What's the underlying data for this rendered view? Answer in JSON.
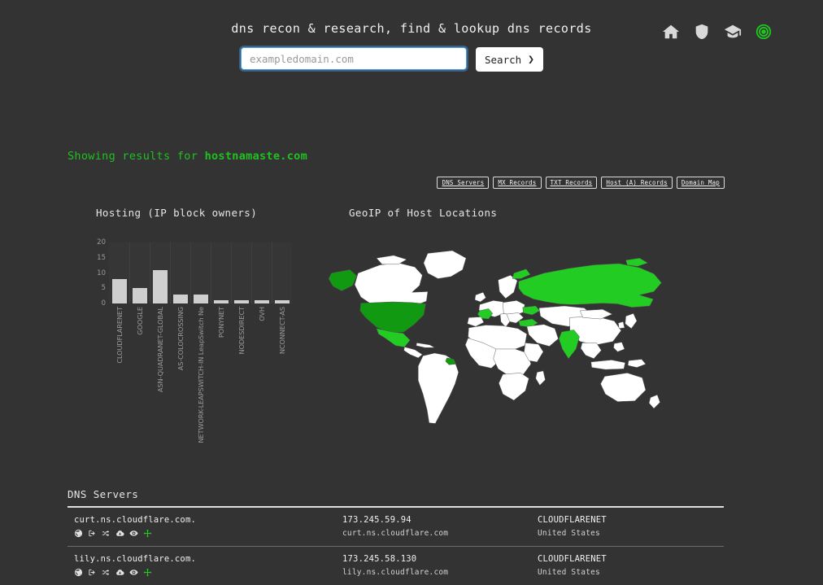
{
  "header": {
    "title": "dns recon & research, find & lookup dns records",
    "icons": [
      {
        "name": "home-icon",
        "label": "Home"
      },
      {
        "name": "shield-icon",
        "label": "Security"
      },
      {
        "name": "graduation-cap-icon",
        "label": "Learn"
      },
      {
        "name": "target-icon",
        "label": "Recon"
      }
    ],
    "accent_color": "#1fc61f"
  },
  "search": {
    "placeholder": "exampledomain.com",
    "value": "",
    "button_label": "Search",
    "button_chevron": "❯",
    "focus_color": "#53a3e0"
  },
  "results": {
    "prefix": "Showing results for",
    "domain": "hostnamaste.com",
    "color": "#20c020"
  },
  "section_nav": [
    {
      "label": "DNS Servers"
    },
    {
      "label": "MX Records"
    },
    {
      "label": "TXT Records"
    },
    {
      "label": "Host (A) Records"
    },
    {
      "label": "Domain Map"
    }
  ],
  "panels": {
    "hosting_title": "Hosting (IP block owners)",
    "geoip_title": "GeoIP of Host Locations"
  },
  "chart_data": {
    "type": "bar",
    "title": "Hosting (IP block owners)",
    "xlabel": "",
    "ylabel": "",
    "ylim": [
      0,
      20
    ],
    "yticks": [
      0,
      5,
      10,
      15,
      20
    ],
    "grid": true,
    "categories": [
      "CLOUDFLARENET",
      "GOOGLE",
      "ASN-QUADRANET-GLOBAL",
      "AS-COLOCROSSING",
      "NETWORK-LEAPSWITCH-IN LeapSwitch Ne",
      "PONYNET",
      "NODESDIRECT",
      "OVH",
      "NCONNECT-AS"
    ],
    "values": [
      8,
      5,
      11,
      3,
      3,
      1,
      1,
      1,
      1
    ],
    "bar_color": "#cfcfcf"
  },
  "map": {
    "type": "choropleth",
    "title": "GeoIP of Host Locations",
    "base_country_color": "#ffffff",
    "highlight_color": "#22cc22",
    "highlight_dark_color": "#119911",
    "background": "#333333",
    "highlighted_countries": [
      "United States",
      "Russia",
      "France",
      "India",
      "Alaska",
      "Ukraine",
      "Turkey",
      "Mexico",
      "French Guiana",
      "Norway"
    ]
  },
  "dns_table": {
    "heading": "DNS Servers",
    "row_icons": [
      {
        "name": "globe-icon"
      },
      {
        "name": "sign-in-icon"
      },
      {
        "name": "shuffle-icon"
      },
      {
        "name": "cloud-download-icon"
      },
      {
        "name": "eye-icon"
      },
      {
        "name": "arrows-move-icon",
        "accent": true
      }
    ],
    "rows": [
      {
        "name": "curt.ns.cloudflare.com.",
        "ip": "173.245.59.94",
        "hostname": "curt.ns.cloudflare.com",
        "org": "CLOUDFLARENET",
        "country": "United States"
      },
      {
        "name": "lily.ns.cloudflare.com.",
        "ip": "173.245.58.130",
        "hostname": "lily.ns.cloudflare.com",
        "org": "CLOUDFLARENET",
        "country": "United States"
      }
    ]
  }
}
